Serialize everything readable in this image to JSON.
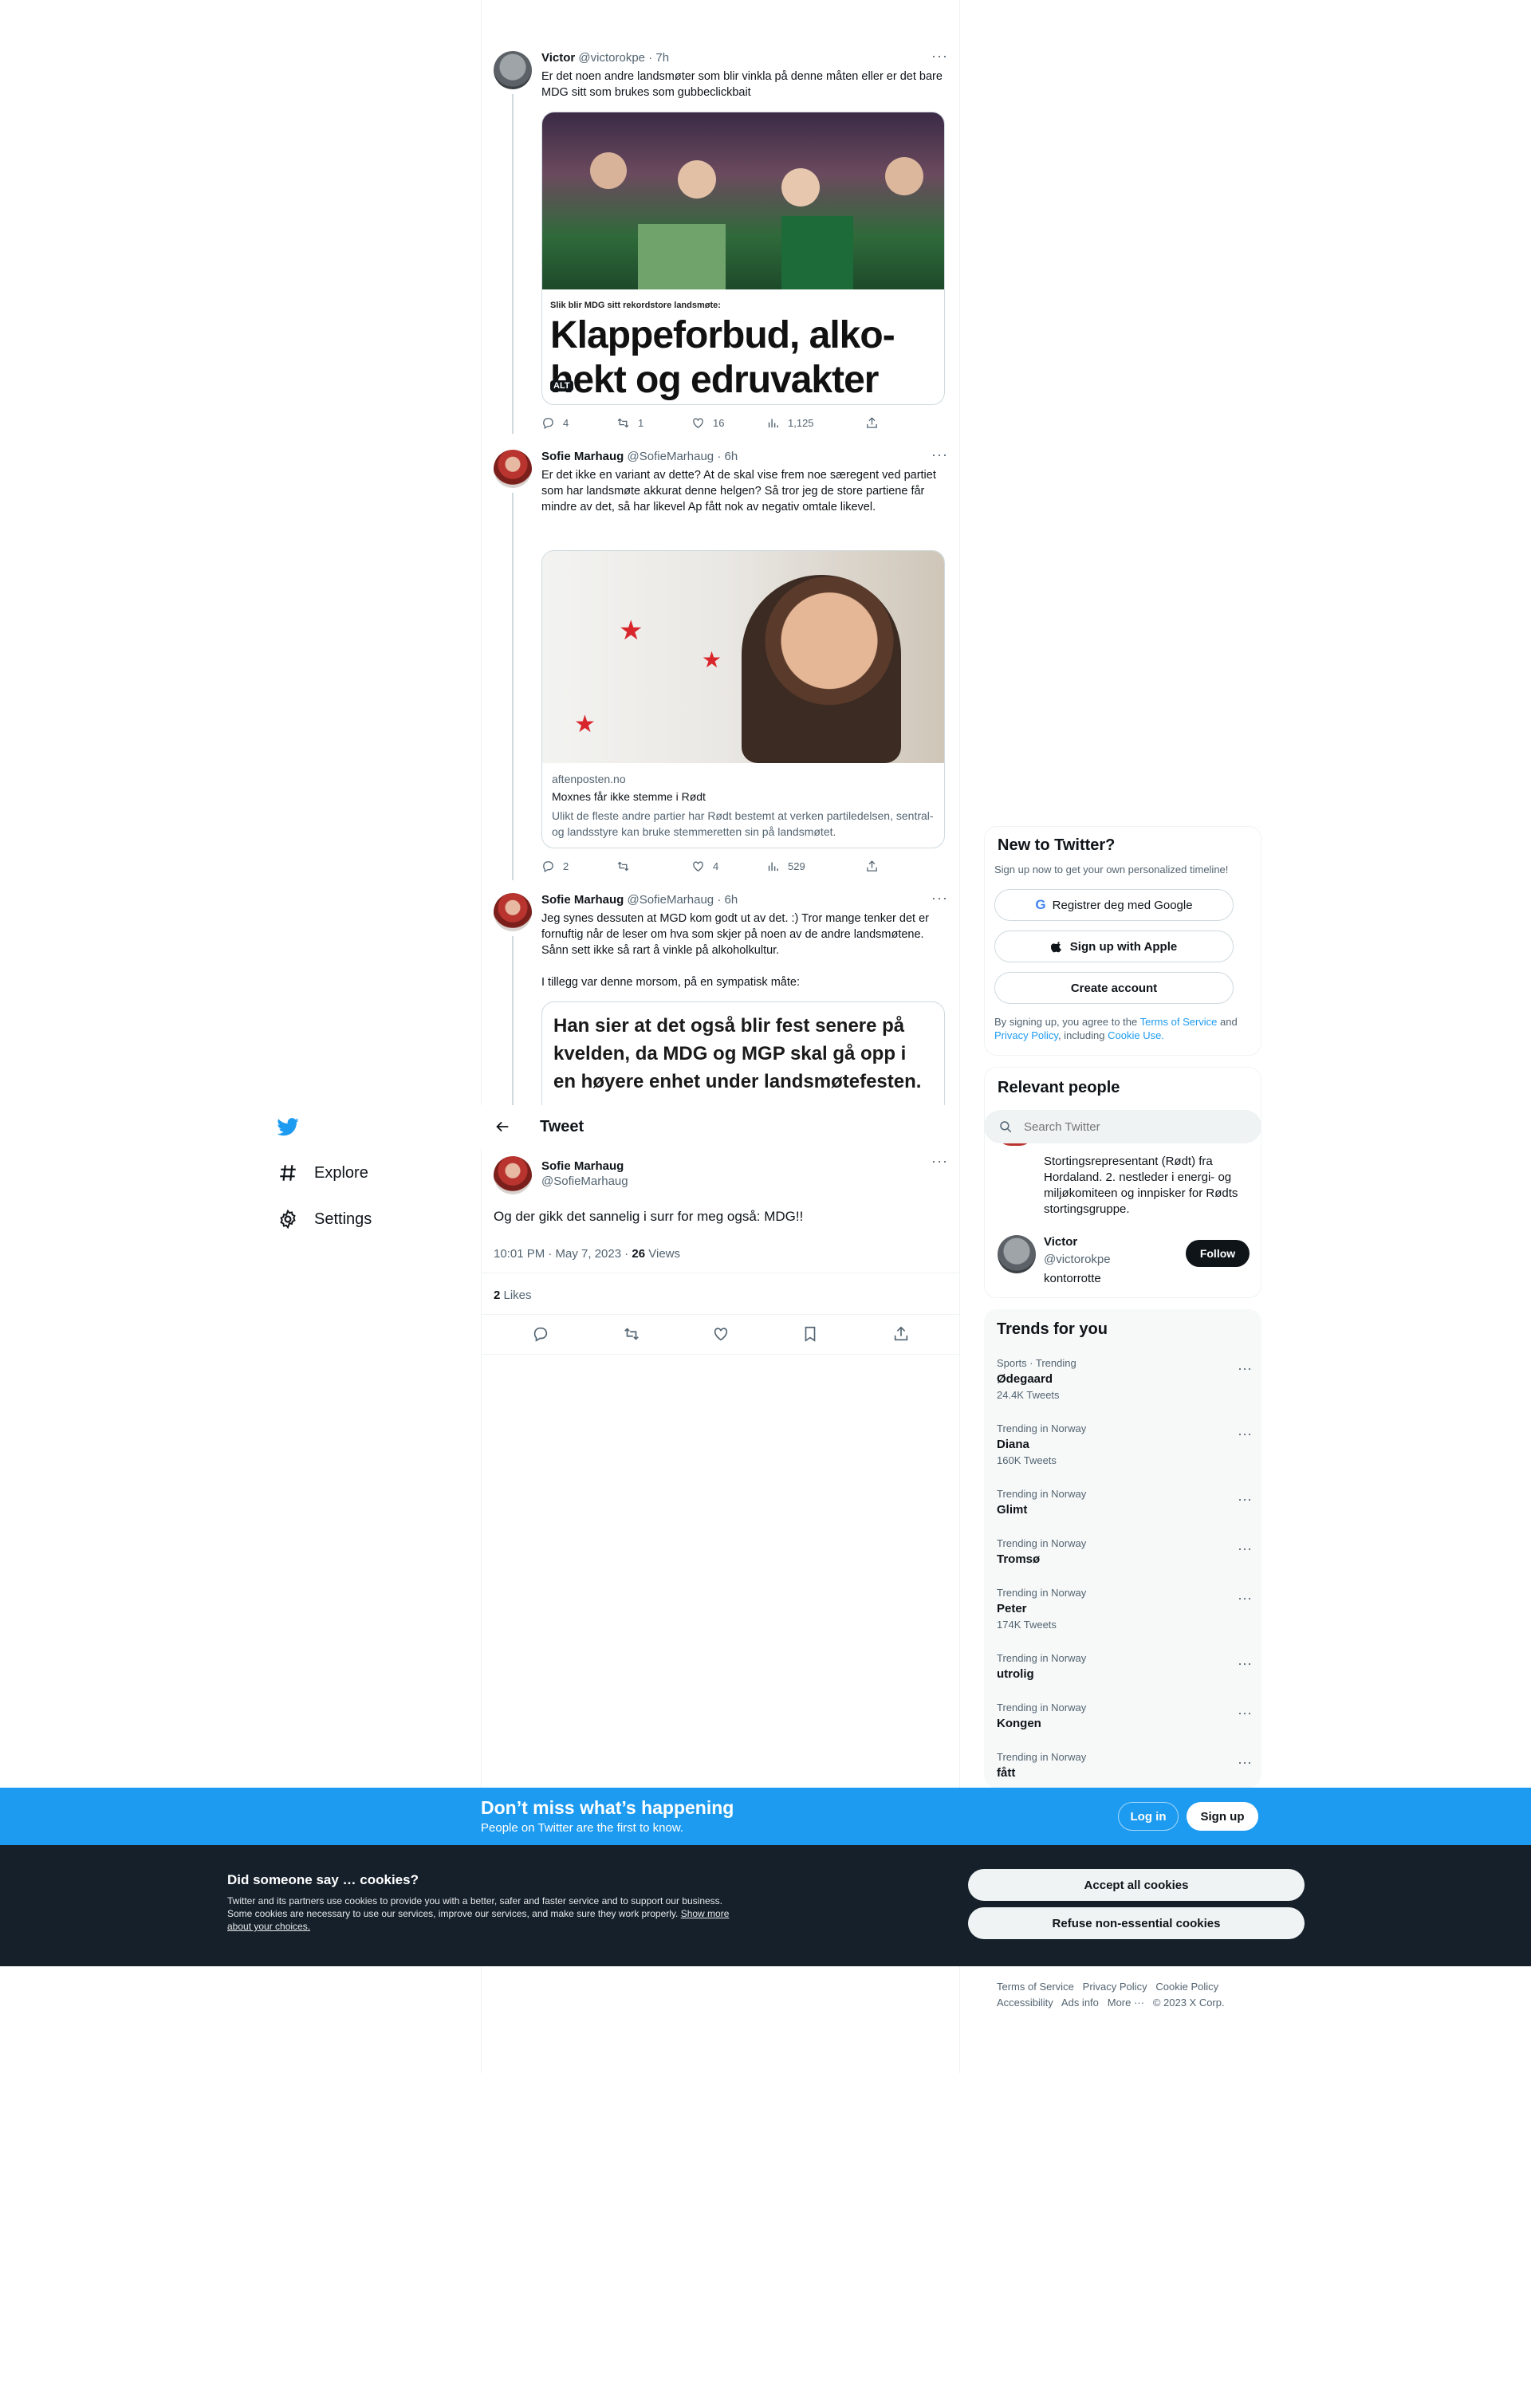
{
  "colors": {
    "twitter_blue": "#1d9bf0",
    "dark_banner": "#15202b",
    "text": "#0f1419",
    "muted": "#536471",
    "link": "#1d9bf0"
  },
  "thread": {
    "tweet1": {
      "name": "Victor",
      "handle": "@victorokpe",
      "time": "· 7h",
      "text": "Er det noen andre landsmøter som blir vinkla på denne måten eller er det bare MDG sitt som brukes som gubbeclickbait",
      "image_caption": "Slik blir MDG sitt rekordstore landsmøte:",
      "image_headline": "Klappeforbud, alko-\nhekt og edruvakter",
      "alt_badge": "ALT",
      "replies": "4",
      "retweets": "1",
      "likes": "16",
      "views": "1,125"
    },
    "tweet2": {
      "name": "Sofie Marhaug",
      "handle": "@SofieMarhaug",
      "time": "· 6h",
      "text": "Er det ikke en variant av dette? At de skal vise frem noe særegent ved partiet som har landsmøte akkurat denne helgen? Så tror jeg de store partiene får mindre av det, så har likevel Ap fått nok av negativ omtale likevel.",
      "card_domain": "aftenposten.no",
      "card_title": "Moxnes får ikke stemme i Rødt",
      "card_desc": "Ulikt de fleste andre partier har Rødt bestemt at verken partiledelsen, sentral- og landsstyre kan bruke stemmeretten sin på landsmøtet.",
      "replies": "2",
      "retweets": "",
      "likes": "4",
      "views": "529"
    },
    "tweet3": {
      "name": "Sofie Marhaug",
      "handle": "@SofieMarhaug",
      "time": "· 6h",
      "text": "Jeg synes dessuten at MGD kom godt ut av det. :) Tror mange tenker det er fornuftig når de leser om hva som skjer på noen av de andre landsmøtene. Sånn sett ikke så rart å vinkle på alkoholkultur.",
      "text2": "I tillegg var denne morsom, på en sympatisk måte:",
      "quote_image_text": "Han sier at det også blir fest senere på kvelden, da MDG og MGP skal gå opp i en høyere enhet under landsmøtefesten."
    }
  },
  "header": {
    "title": "Tweet",
    "back_icon": "arrow-left-icon"
  },
  "main_tweet": {
    "name": "Sofie Marhaug",
    "handle": "@SofieMarhaug",
    "text": "Og der gikk det sannelig i surr for meg også: MDG!!",
    "timestamp": "10:01 PM · May 7, 2023 · ",
    "views_count": "26",
    "views_label": " Views",
    "likes_count": "2",
    "likes_label": " Likes"
  },
  "nav": {
    "explore": "Explore",
    "settings": "Settings"
  },
  "new_to_twitter": {
    "title": "New to Twitter?",
    "subtitle": "Sign up now to get your own personalized timeline!",
    "google": "Registrer deg med Google",
    "apple": "Sign up with Apple",
    "create": "Create account",
    "legal_1": "By signing up, you agree to the ",
    "terms": "Terms of Service",
    "legal_2": " and ",
    "privacy": "Privacy Policy",
    "legal_3": ", including ",
    "cookie": "Cookie Use."
  },
  "search": {
    "placeholder": "Search Twitter"
  },
  "relevant_people": {
    "title": "Relevant people",
    "bio_partial": "Stortingsrepresentant (Rødt) fra Hordaland. 2. nestleder i energi- og miljøkomiteen og innpisker for Rødts stortingsgruppe.",
    "person2_name": "Victor",
    "person2_handle": "@victorokpe",
    "person2_bio": "kontorrotte",
    "follow": "Follow"
  },
  "trends": {
    "title": "Trends for you",
    "items": [
      {
        "category": "Sports · Trending",
        "name": "Ødegaard",
        "count": "24.4K Tweets"
      },
      {
        "category": "Trending in Norway",
        "name": "Diana",
        "count": "160K Tweets"
      },
      {
        "category": "Trending in Norway",
        "name": "Glimt",
        "count": ""
      },
      {
        "category": "Trending in Norway",
        "name": "Tromsø",
        "count": ""
      },
      {
        "category": "Trending in Norway",
        "name": "Peter",
        "count": "174K Tweets"
      },
      {
        "category": "Trending in Norway",
        "name": "utrolig",
        "count": ""
      },
      {
        "category": "Trending in Norway",
        "name": "Kongen",
        "count": ""
      },
      {
        "category": "Trending in Norway",
        "name": "fått",
        "count": ""
      }
    ]
  },
  "signup_banner": {
    "title": "Don’t miss what’s happening",
    "subtitle": "People on Twitter are the first to know.",
    "login": "Log in",
    "signup": "Sign up"
  },
  "cookies": {
    "title": "Did someone say … cookies?",
    "body": "Twitter and its partners use cookies to provide you with a better, safer and faster service and to support our business. Some cookies are necessary to use our services, improve our services, and make sure they work properly. ",
    "link": "Show more about your choices.",
    "accept": "Accept all cookies",
    "refuse": "Refuse non-essential cookies"
  },
  "footer": {
    "terms": "Terms of Service",
    "privacy": "Privacy Policy",
    "cookie": "Cookie Policy",
    "accessibility": "Accessibility",
    "ads": "Ads info",
    "more": "More ···",
    "copyright": "© 2023 X Corp."
  }
}
